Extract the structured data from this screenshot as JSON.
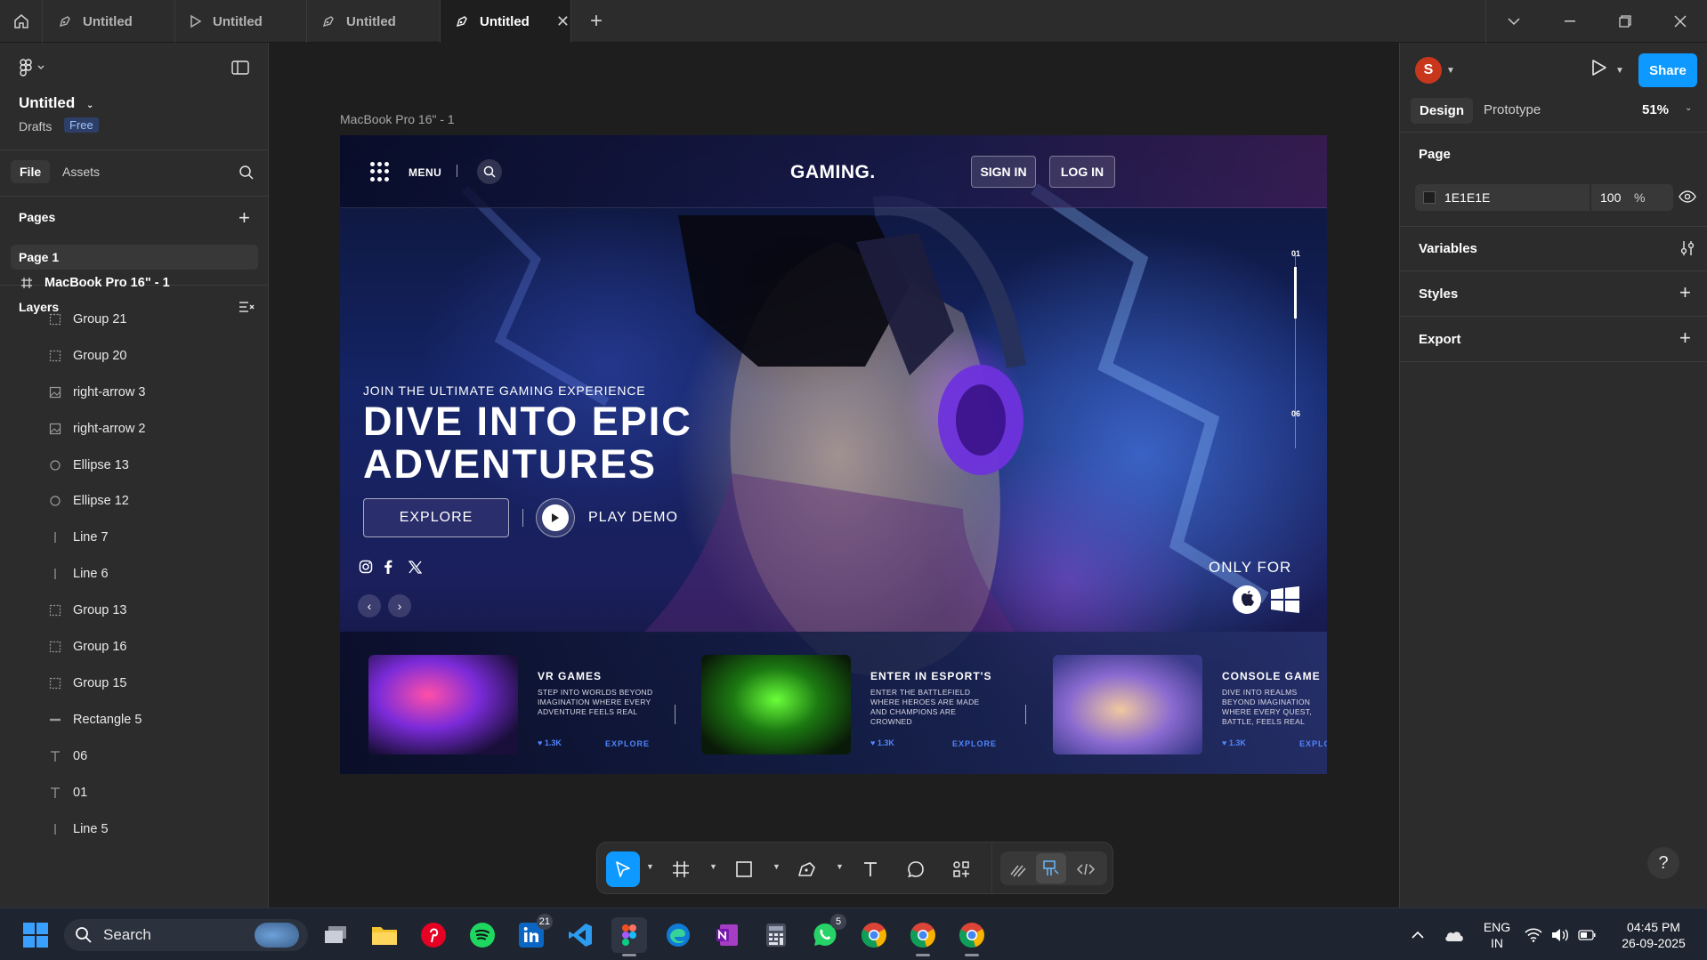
{
  "tabs": [
    {
      "label": "Untitled",
      "kind": "design"
    },
    {
      "label": "Untitled",
      "kind": "prototype"
    },
    {
      "label": "Untitled",
      "kind": "design"
    },
    {
      "label": "Untitled",
      "kind": "design",
      "active": true
    }
  ],
  "file": {
    "name": "Untitled",
    "location": "Drafts",
    "plan": "Free"
  },
  "left_tabs": {
    "file": "File",
    "assets": "Assets"
  },
  "pages": {
    "header": "Pages",
    "items": [
      "Page 1"
    ]
  },
  "layers": {
    "header": "Layers",
    "items": [
      {
        "name": "MacBook Pro 16\" - 1",
        "icon": "frame-icon"
      },
      {
        "name": "Group 21",
        "icon": "group-icon"
      },
      {
        "name": "Group 20",
        "icon": "group-icon"
      },
      {
        "name": "right-arrow 3",
        "icon": "image-icon"
      },
      {
        "name": "right-arrow 2",
        "icon": "image-icon"
      },
      {
        "name": "Ellipse 13",
        "icon": "ellipse-icon"
      },
      {
        "name": "Ellipse 12",
        "icon": "ellipse-icon"
      },
      {
        "name": "Line 7",
        "icon": "line-icon"
      },
      {
        "name": "Line 6",
        "icon": "line-icon"
      },
      {
        "name": "Group 13",
        "icon": "group-icon"
      },
      {
        "name": "Group 16",
        "icon": "group-icon"
      },
      {
        "name": "Group 15",
        "icon": "group-icon"
      },
      {
        "name": "Rectangle 5",
        "icon": "rectangle-icon"
      },
      {
        "name": "06",
        "icon": "text-icon"
      },
      {
        "name": "01",
        "icon": "text-icon"
      },
      {
        "name": "Line 5",
        "icon": "line-icon"
      }
    ]
  },
  "canvas": {
    "frame_label": "MacBook Pro 16\" - 1",
    "site": {
      "menu": "MENU",
      "logo": "GAMING.",
      "sign_in": "SIGN IN",
      "log_in": "LOG IN",
      "kicker": "JOIN THE ULTIMATE GAMING EXPERIENCE",
      "title_line1": "DIVE INTO EPIC",
      "title_line2": "ADVENTURES",
      "explore": "EXPLORE",
      "play_demo": "PLAY DEMO",
      "slider_start": "01",
      "slider_end": "06",
      "only_for": "ONLY FOR",
      "cards": [
        {
          "title": "VR GAMES",
          "desc": "STEP INTO WORLDS BEYOND IMAGINATION WHERE EVERY ADVENTURE FEELS REAL",
          "likes": "1.3K",
          "cta": "EXPLORE"
        },
        {
          "title": "ENTER IN ESPORT'S",
          "desc": "ENTER THE BATTLEFIELD WHERE HEROES ARE MADE AND CHAMPIONS ARE CROWNED",
          "likes": "1.3K",
          "cta": "EXPLORE"
        },
        {
          "title": "CONSOLE GAME",
          "desc": "DIVE INTO REALMS BEYOND IMAGINATION WHERE EVERY QUEST, BATTLE, FEELS REAL",
          "likes": "1.3K",
          "cta": "EXPLORE"
        }
      ]
    }
  },
  "right": {
    "avatar_initial": "S",
    "share": "Share",
    "design_tab": "Design",
    "prototype_tab": "Prototype",
    "zoom": "51%",
    "page_header": "Page",
    "bg_hex": "1E1E1E",
    "bg_opacity": "100",
    "pct": "%",
    "variables": "Variables",
    "styles": "Styles",
    "export": "Export",
    "help": "?"
  },
  "taskbar": {
    "search_placeholder": "Search",
    "linkedin_badge": "21",
    "whatsapp_badge": "5",
    "lang_top": "ENG",
    "lang_bottom": "IN",
    "time": "04:45 PM",
    "date": "26-09-2025"
  },
  "colors": {
    "accent": "#0d99ff",
    "panel": "#2c2c2c",
    "canvas": "#1e1e1e",
    "avatar": "#c8371c"
  }
}
